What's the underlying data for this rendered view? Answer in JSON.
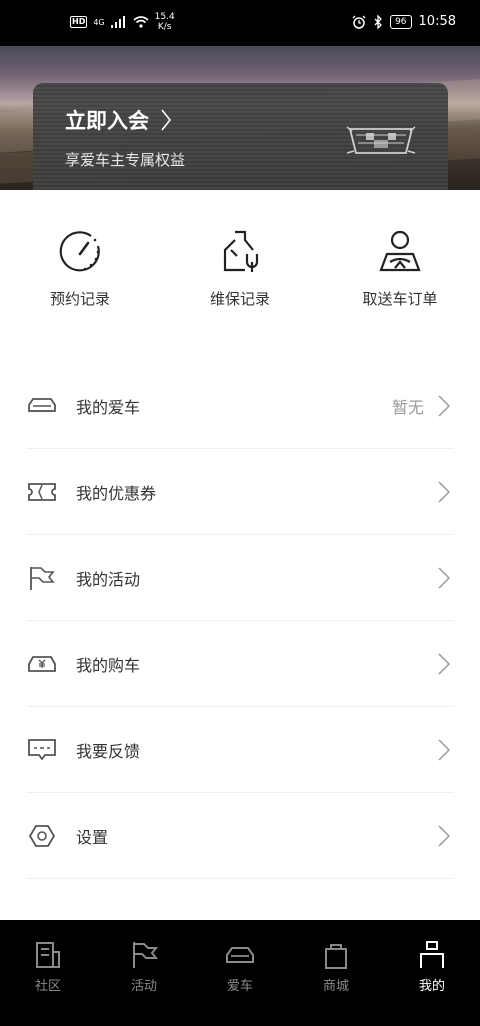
{
  "status_bar": {
    "hd": "HD",
    "network": "4G",
    "speed_value": "15.4",
    "speed_unit": "K/s",
    "battery": "96",
    "time": "10:58"
  },
  "member": {
    "title": "立即入会",
    "subtitle": "享爱车主专属权益"
  },
  "quick_actions": [
    {
      "label": "预约记录",
      "icon": "speedometer-icon"
    },
    {
      "label": "维保记录",
      "icon": "wrench-bottle-icon"
    },
    {
      "label": "取送车订单",
      "icon": "driver-icon"
    }
  ],
  "menu": [
    {
      "label": "我的爱车",
      "value": "暂无",
      "icon": "car-icon"
    },
    {
      "label": "我的优惠券",
      "value": "",
      "icon": "coupon-icon"
    },
    {
      "label": "我的活动",
      "value": "",
      "icon": "flag-icon"
    },
    {
      "label": "我的购车",
      "value": "",
      "icon": "car-purchase-icon"
    },
    {
      "label": "我要反馈",
      "value": "",
      "icon": "feedback-icon"
    },
    {
      "label": "设置",
      "value": "",
      "icon": "settings-icon"
    }
  ],
  "tabs": [
    {
      "label": "社区",
      "icon": "community-icon",
      "active": false
    },
    {
      "label": "活动",
      "icon": "flag-icon",
      "active": false
    },
    {
      "label": "爱车",
      "icon": "car-icon",
      "active": false
    },
    {
      "label": "商城",
      "icon": "shopping-bag-icon",
      "active": false
    },
    {
      "label": "我的",
      "icon": "profile-icon",
      "active": true
    }
  ],
  "colors": {
    "tabbar_bg": "#000000",
    "active_tab": "#ffffff",
    "inactive_tab": "#8a8a8a"
  }
}
